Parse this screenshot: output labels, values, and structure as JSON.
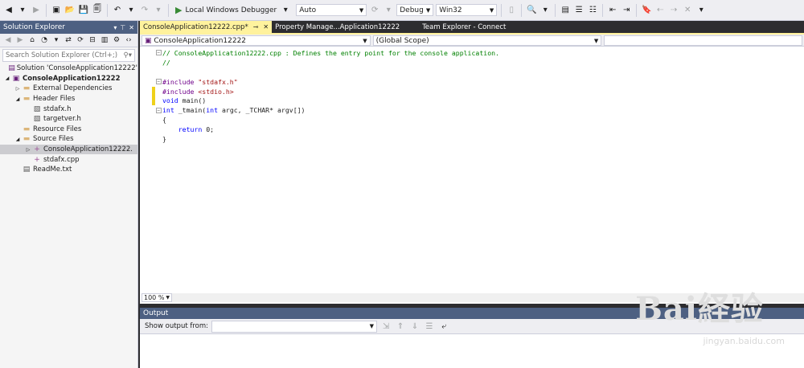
{
  "toolbar": {
    "debugger_label": "Local Windows Debugger",
    "auto_value": "Auto",
    "config_value": "Debug",
    "platform_value": "Win32"
  },
  "solution_explorer": {
    "title": "Solution Explorer",
    "search_placeholder": "Search Solution Explorer (Ctrl+;)",
    "items": [
      {
        "label": "Solution 'ConsoleApplication12222'",
        "level": 0,
        "icon": "solution-icon",
        "expander": "",
        "bold": false
      },
      {
        "label": "ConsoleApplication12222",
        "level": 0,
        "icon": "project-icon",
        "expander": "expanded",
        "bold": true
      },
      {
        "label": "External Dependencies",
        "level": 1,
        "icon": "folder-icon",
        "expander": "collapsed",
        "bold": false
      },
      {
        "label": "Header Files",
        "level": 1,
        "icon": "folder-icon",
        "expander": "expanded",
        "bold": false
      },
      {
        "label": "stdafx.h",
        "level": 2,
        "icon": "header-file-icon",
        "expander": "",
        "bold": false
      },
      {
        "label": "targetver.h",
        "level": 2,
        "icon": "header-file-icon",
        "expander": "",
        "bold": false
      },
      {
        "label": "Resource Files",
        "level": 1,
        "icon": "folder-icon",
        "expander": "",
        "bold": false
      },
      {
        "label": "Source Files",
        "level": 1,
        "icon": "folder-icon",
        "expander": "expanded",
        "bold": false
      },
      {
        "label": "ConsoleApplication12222.",
        "level": 2,
        "icon": "cpp-file-icon",
        "expander": "collapsed",
        "bold": false,
        "selected": true
      },
      {
        "label": "stdafx.cpp",
        "level": 2,
        "icon": "cpp-file-icon",
        "expander": "",
        "bold": false
      },
      {
        "label": "ReadMe.txt",
        "level": 1,
        "icon": "text-file-icon",
        "expander": "",
        "bold": false
      }
    ]
  },
  "tabs": [
    {
      "label": "ConsoleApplication12222.cpp*",
      "active": true
    },
    {
      "label": "Property Manage...Application12222",
      "active": false
    },
    {
      "label": "Team Explorer - Connect",
      "active": false
    }
  ],
  "editor": {
    "project_dropdown": "ConsoleApplication12222",
    "scope_dropdown": "(Global Scope)",
    "zoom": "100 %",
    "lines": [
      {
        "fold": "box-start",
        "mod": false,
        "tokens": [
          {
            "t": "// ConsoleApplication12222.cpp : Defines the entry point for the console application.",
            "c": "cmt"
          }
        ]
      },
      {
        "fold": "vline",
        "mod": false,
        "tokens": [
          {
            "t": "//",
            "c": "cmt"
          }
        ]
      },
      {
        "fold": "",
        "mod": false,
        "tokens": []
      },
      {
        "fold": "box-start",
        "mod": false,
        "tokens": [
          {
            "t": "#include ",
            "c": "pp"
          },
          {
            "t": "\"stdafx.h\"",
            "c": "str"
          }
        ]
      },
      {
        "fold": "",
        "mod": true,
        "tokens": [
          {
            "t": "#include ",
            "c": "pp"
          },
          {
            "t": "<stdio.h>",
            "c": "str"
          }
        ]
      },
      {
        "fold": "",
        "mod": true,
        "tokens": [
          {
            "t": "void",
            "c": "kw"
          },
          {
            "t": " main()",
            "c": ""
          }
        ]
      },
      {
        "fold": "box-start",
        "mod": false,
        "tokens": [
          {
            "t": "int",
            "c": "kw"
          },
          {
            "t": " _tmain(",
            "c": ""
          },
          {
            "t": "int",
            "c": "kw"
          },
          {
            "t": " argc, _TCHAR* argv[])",
            "c": ""
          }
        ]
      },
      {
        "fold": "vline",
        "mod": false,
        "tokens": [
          {
            "t": "{",
            "c": ""
          }
        ]
      },
      {
        "fold": "vline",
        "mod": false,
        "tokens": [
          {
            "t": "    ",
            "c": ""
          },
          {
            "t": "return",
            "c": "kw"
          },
          {
            "t": " 0;",
            "c": ""
          }
        ]
      },
      {
        "fold": "vline",
        "mod": false,
        "tokens": [
          {
            "t": "}",
            "c": ""
          }
        ]
      }
    ]
  },
  "output": {
    "title": "Output",
    "show_from_label": "Show output from:",
    "show_from_value": ""
  },
  "watermark": {
    "main": "Bai経验",
    "sub": "jingyan.baidu.com"
  },
  "colors": {
    "title_bar": "#4d6082",
    "active_tab": "#fff29d",
    "modified_marker": "#efd11a",
    "comment": "#008000",
    "keyword": "#0000ff",
    "preprocessor": "#6f008a",
    "string": "#a31515"
  }
}
